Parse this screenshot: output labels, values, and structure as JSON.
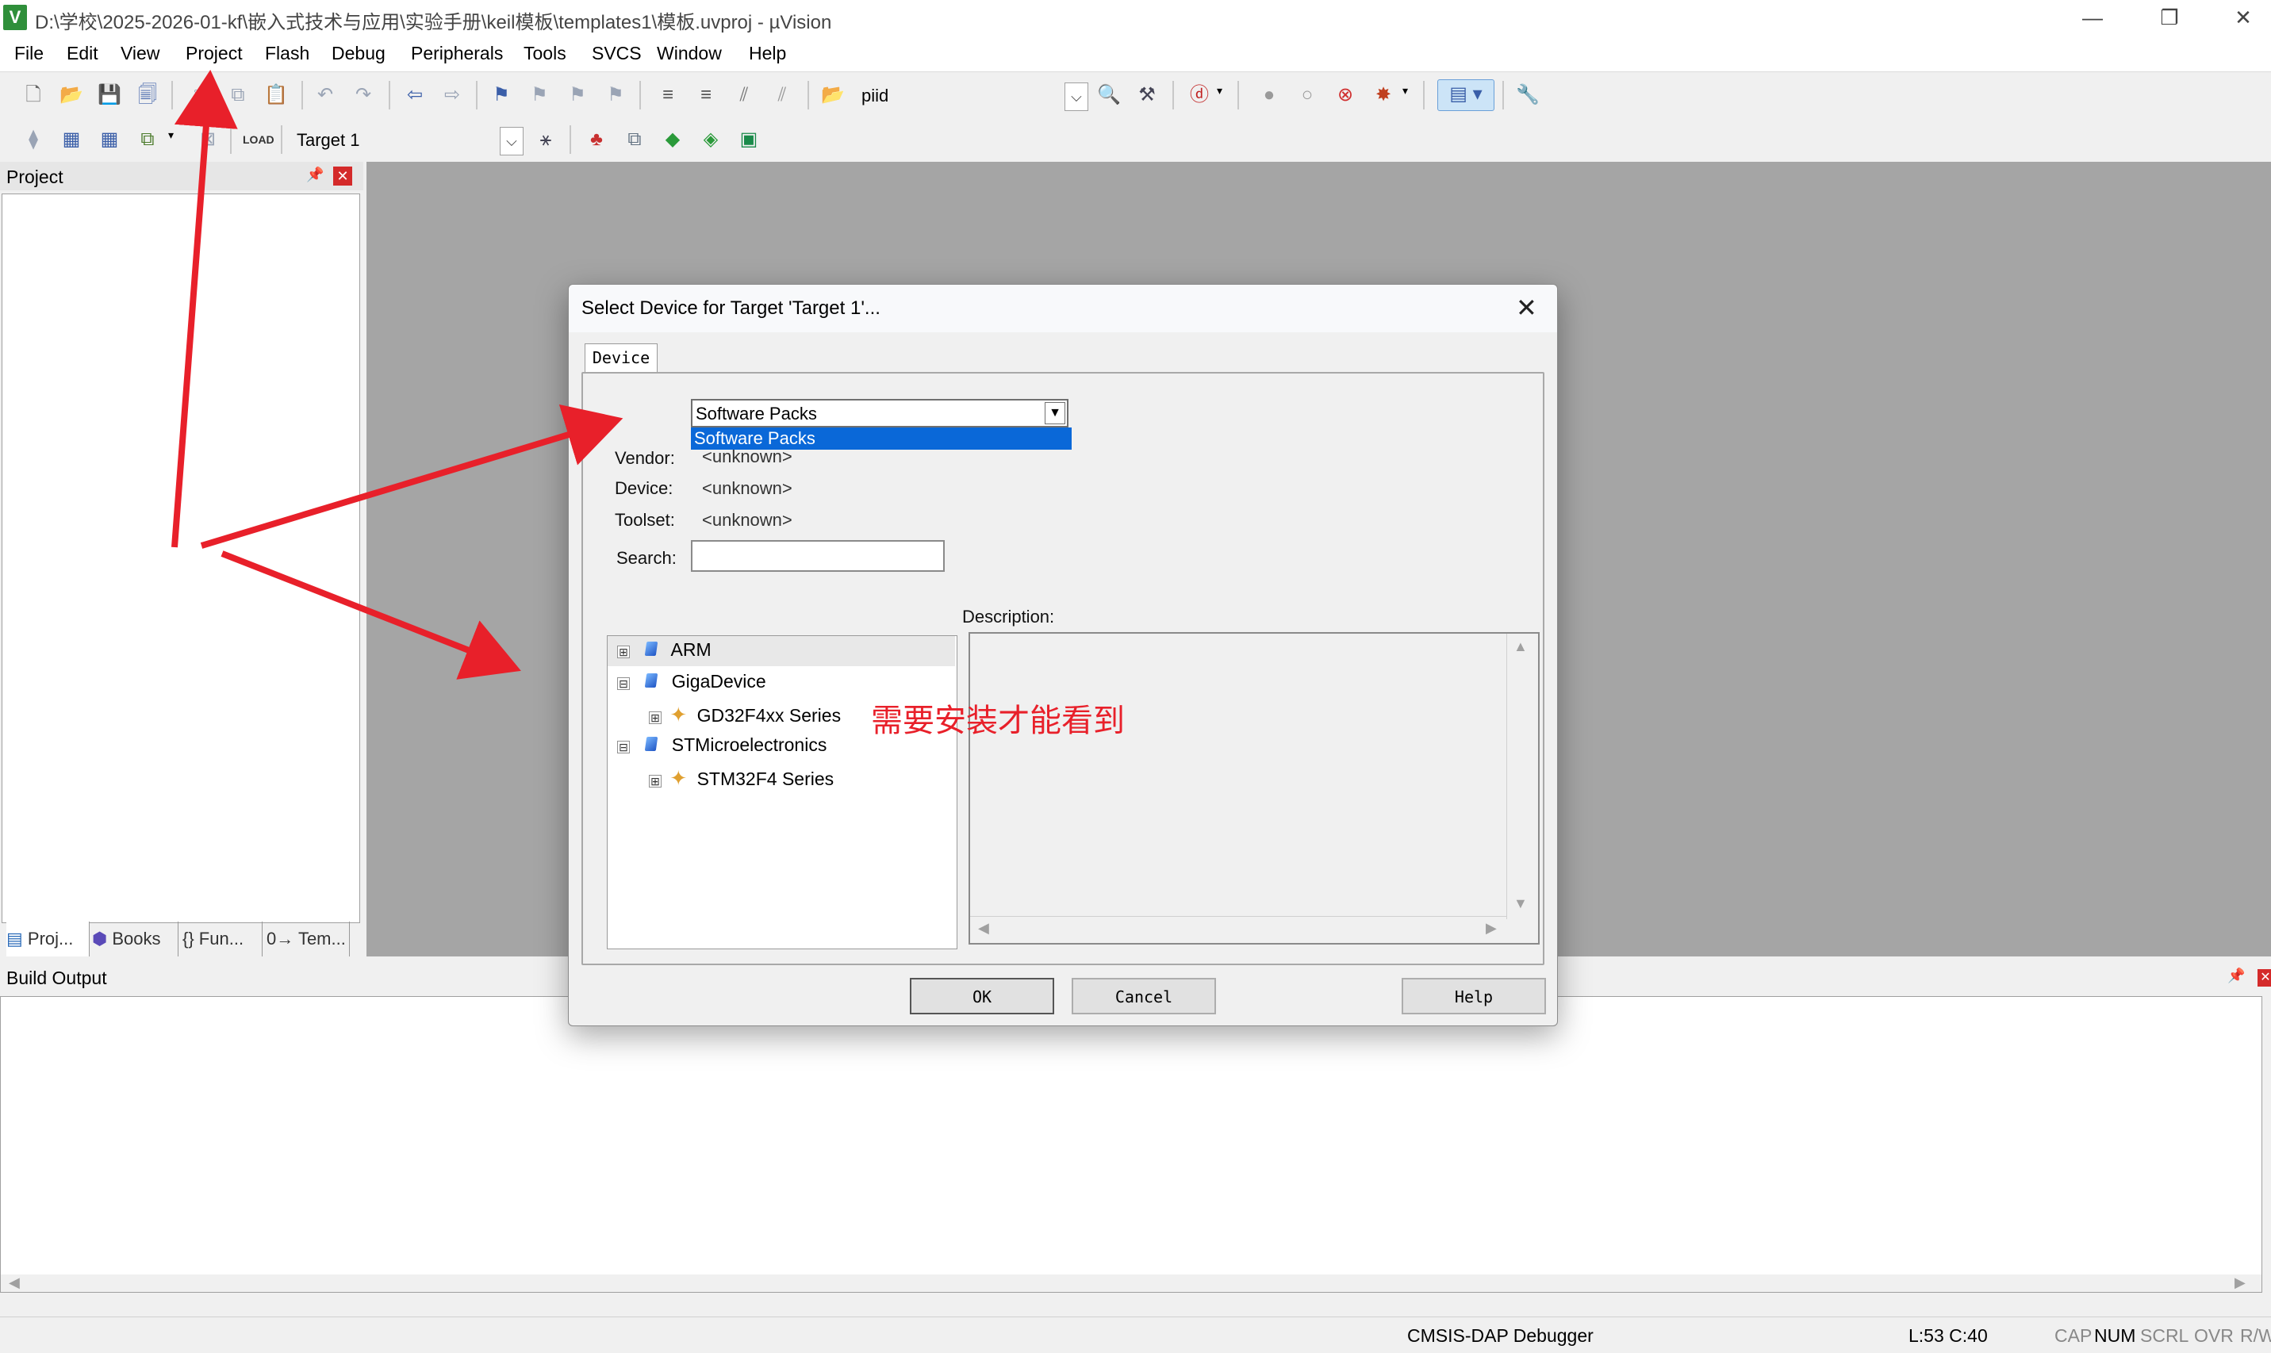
{
  "window": {
    "title": "D:\\学校\\2025-2026-01-kf\\嵌入式技术与应用\\实验手册\\keil模板\\templates1\\模板.uvproj - µVision",
    "minimize": "—",
    "restore": "❐",
    "close": "✕"
  },
  "menu": [
    "File",
    "Edit",
    "View",
    "Project",
    "Flash",
    "Debug",
    "Peripherals",
    "Tools",
    "SVCS",
    "Window",
    "Help"
  ],
  "toolbar": {
    "find_combo": "piid",
    "target_combo": "Target 1"
  },
  "project_pane": {
    "title": "Project",
    "tabs": [
      "Proj...",
      "Books",
      "{} Fun...",
      "0→ Tem..."
    ]
  },
  "build_output": {
    "title": "Build Output"
  },
  "statusbar": {
    "debugger": "CMSIS-DAP Debugger",
    "position": "L:53 C:40",
    "cap": "CAP",
    "num": "NUM",
    "scrl": "SCRL",
    "ovr": "OVR",
    "rw": "R/W"
  },
  "dialog": {
    "title": "Select Device for Target 'Target 1'...",
    "tab": "Device",
    "pack_select": "Software Packs",
    "pack_option": "Software Packs",
    "vendor_label": "Vendor:",
    "vendor_value": "<unknown>",
    "device_label": "Device:",
    "device_value": "<unknown>",
    "toolset_label": "Toolset:",
    "toolset_value": "<unknown>",
    "search_label": "Search:",
    "search_value": "",
    "description_label": "Description:",
    "tree": [
      {
        "label": "ARM",
        "expander": "⊞"
      },
      {
        "label": "GigaDevice",
        "expander": "⊟"
      },
      {
        "label": "GD32F4xx Series",
        "expander": "⊞"
      },
      {
        "label": "STMicroelectronics",
        "expander": "⊟"
      },
      {
        "label": "STM32F4 Series",
        "expander": "⊞"
      }
    ],
    "ok": "OK",
    "cancel": "Cancel",
    "help": "Help"
  },
  "annotation": {
    "note": "需要安装才能看到",
    "arrow_color": "#e8202a"
  }
}
